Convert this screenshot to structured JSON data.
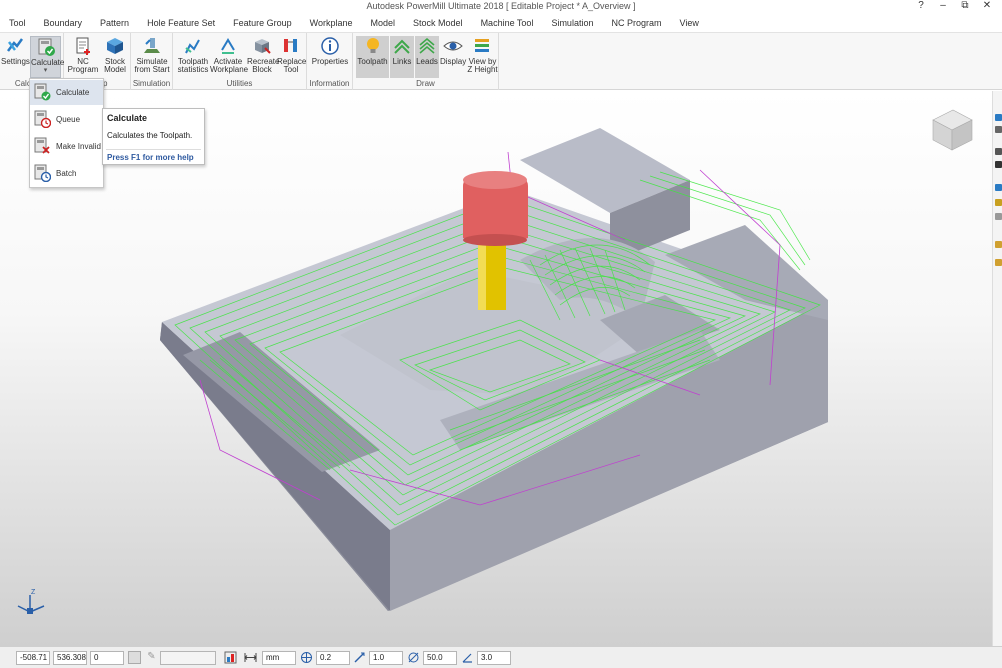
{
  "window": {
    "title": "Autodesk PowerMill Ultimate 2018   [ Editable Project * A_Overview ]",
    "controls": [
      "?",
      "–",
      "⧉",
      "✕"
    ]
  },
  "menu": {
    "tabs": [
      "Tool",
      "Boundary",
      "Pattern",
      "Hole Feature Set",
      "Feature Group",
      "Workplane",
      "Model",
      "Stock Model",
      "Machine Tool",
      "Simulation",
      "NC Program",
      "View"
    ]
  },
  "ribbon": {
    "groups": {
      "calculate": "Calculate",
      "nc": "Setup",
      "simulation": "Simulation",
      "utilities": "Utilities",
      "information": "Information",
      "draw": "Draw"
    },
    "buttons": {
      "settings": "Settings",
      "calculate": "Calculate",
      "nc_program": "NC\nProgram",
      "stock_model": "Stock\nModel",
      "simulate_from_start": "Simulate\nfrom Start",
      "toolpath_statistics": "Toolpath\nstatistics",
      "activate_workplane": "Activate\nWorkplane",
      "recreate_block": "Recreate\nBlock",
      "replace_tool": "Replace\nTool",
      "properties": "Properties",
      "toolpath": "Toolpath",
      "links": "Links",
      "leads": "Leads",
      "display": "Display",
      "view_by_z_height": "View by\nZ Height"
    }
  },
  "dropdown": {
    "items": [
      "Calculate",
      "Queue",
      "Make Invalid",
      "Batch"
    ]
  },
  "tooltip": {
    "title": "Calculate",
    "description": "Calculates the Toolpath.",
    "help": "Press F1 for more help"
  },
  "triad": {
    "z": "Z"
  },
  "status": {
    "x": "-508.71",
    "y": "536.308",
    "z": "0",
    "units": "mm",
    "tolerance": "0.2",
    "stepover": "1.0",
    "diameter": "50.0",
    "angle": "3.0"
  },
  "colors": {
    "toolpath": "#3ee63e",
    "links": "#c040d0",
    "tool_tip": "#e1c200",
    "tool_holder": "#e26a6a",
    "part_top": "#c9ccd6",
    "part_side": "#8a8c99"
  }
}
